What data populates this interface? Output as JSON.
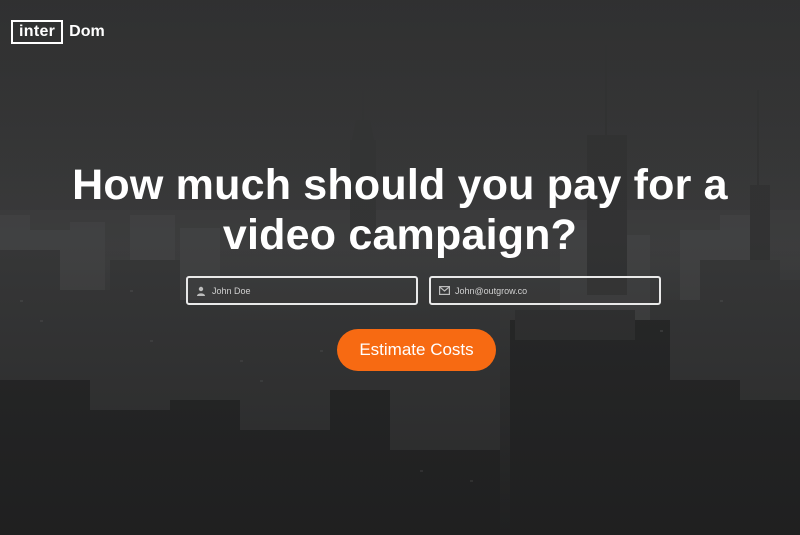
{
  "brand": {
    "box_text": "inter",
    "text": "Dom"
  },
  "hero": {
    "headline": [
      "How much should you pay for a",
      "video campaign?"
    ]
  },
  "form": {
    "name_placeholder": "John Doe",
    "email_placeholder": "John@outgrow.co",
    "submit_label": "Estimate Costs"
  },
  "colors": {
    "accent": "#f76a12",
    "text": "#ffffff",
    "field_border": "#e9e9e9"
  },
  "icons": {
    "name_field": "person-icon",
    "email_field": "envelope-icon"
  }
}
